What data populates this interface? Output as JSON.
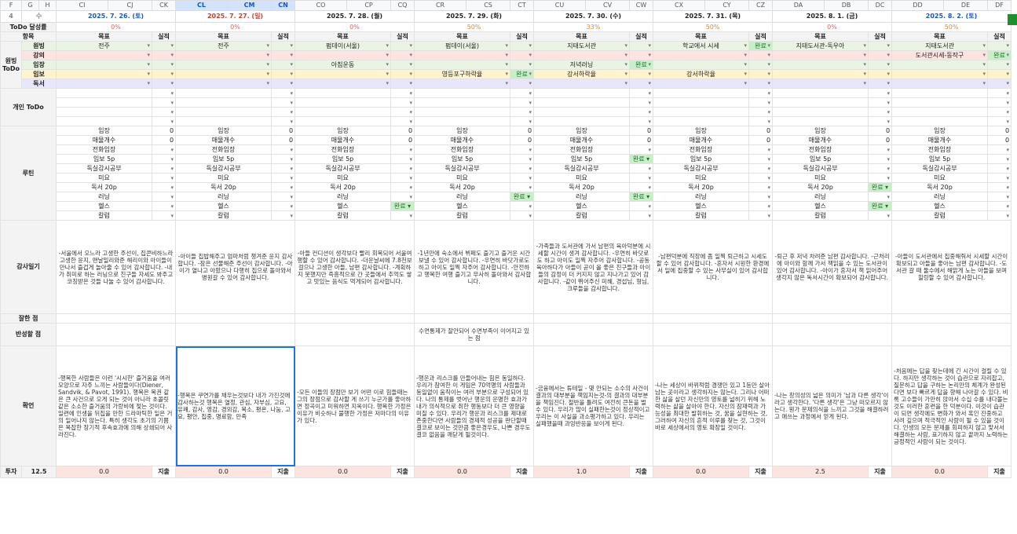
{
  "sheet": {
    "col_letters_left": [
      "F",
      "G",
      "H"
    ],
    "row_num": "4",
    "row_num_label": "수",
    "days": [
      {
        "cols": [
          "CI",
          "CJ",
          "CK"
        ],
        "date": "2025. 7. 26. (토)",
        "tone": "blue",
        "todo_pct": "0%",
        "selected": false
      },
      {
        "cols": [
          "CL",
          "CM",
          "CN"
        ],
        "date": "2025. 7. 27. (일)",
        "tone": "red",
        "todo_pct": "0%",
        "selected": true
      },
      {
        "cols": [
          "CO",
          "CP",
          "CQ"
        ],
        "date": "2025. 7. 28. (월)",
        "tone": "dark",
        "todo_pct": "0%",
        "selected": false
      },
      {
        "cols": [
          "CR",
          "CS",
          "CT"
        ],
        "date": "2025. 7. 29. (화)",
        "tone": "dark",
        "todo_pct": "50%",
        "selected": false
      },
      {
        "cols": [
          "CU",
          "CV",
          "CW"
        ],
        "date": "2025. 7. 30. (수)",
        "tone": "dark",
        "todo_pct": "33%",
        "selected": false
      },
      {
        "cols": [
          "CX",
          "CY",
          "CZ"
        ],
        "date": "2025. 7. 31. (목)",
        "tone": "dark",
        "todo_pct": "50%",
        "selected": false
      },
      {
        "cols": [
          "DA",
          "DB",
          "DC"
        ],
        "date": "2025. 8. 1. (금)",
        "tone": "dark",
        "todo_pct": "0%",
        "selected": false
      },
      {
        "cols": [
          "DD",
          "DE",
          "DF"
        ],
        "date": "2025. 8. 2. (토)",
        "tone": "blue",
        "todo_pct": "50%",
        "selected": false
      }
    ]
  },
  "labels": {
    "todo_rate": "ToDo 달성률",
    "item": "항목",
    "goal": "목표",
    "result": "실적",
    "wonbing_todo": "원빙 ToDo",
    "personal_todo": "개인 ToDo",
    "routine": "루틴",
    "gratitude": "감사일기",
    "good": "잘한 점",
    "reflect": "반성할 점",
    "confirm": "확언",
    "invest": "투자",
    "invest_value": "12.5",
    "expense": "지출"
  },
  "wonbing_rows": [
    {
      "name": "원빙",
      "tone": "g1",
      "goals": [
        "전주",
        "전주",
        "펌데이(서울)",
        "펌데이(서울)",
        "지태도서관",
        "학교에서 시세",
        "지태도서관-독우아",
        "지태도서관"
      ],
      "results": [
        "",
        "",
        "",
        "",
        "",
        "완료",
        "",
        ""
      ]
    },
    {
      "name": "강의",
      "tone": "r1",
      "goals": [
        "",
        "",
        "",
        "",
        "",
        "",
        "",
        "도서관시세-동작구"
      ],
      "results": [
        "",
        "",
        "",
        "",
        "",
        "",
        "",
        "완료"
      ]
    },
    {
      "name": "임장",
      "tone": "g1",
      "goals": [
        "",
        "",
        "아침운동",
        "",
        "저녁러닝",
        "",
        "",
        ""
      ],
      "results": [
        "",
        "",
        "",
        "",
        "완료",
        "",
        "",
        ""
      ]
    },
    {
      "name": "임보",
      "tone": "y1",
      "goals": [
        "",
        "",
        "",
        "영등포구하락율",
        "강서하락율",
        "강서하락율",
        "",
        ""
      ],
      "results": [
        "",
        "",
        "",
        "완료",
        "",
        "",
        "",
        ""
      ]
    },
    {
      "name": "독서",
      "tone": "p1",
      "goals": [
        "",
        "",
        "",
        "",
        "",
        "",
        "",
        ""
      ],
      "results": [
        "",
        "",
        "",
        "",
        "",
        "",
        "",
        ""
      ]
    }
  ],
  "routines": [
    {
      "name": "임장",
      "value": "0"
    },
    {
      "name": "매물개수",
      "value": "0"
    },
    {
      "name": "전화임장",
      "value": ""
    },
    {
      "name": "임보 5p",
      "value": ""
    },
    {
      "name": "독실감시공부",
      "value": ""
    },
    {
      "name": "미요",
      "value": ""
    },
    {
      "name": "독서 20p",
      "value": ""
    },
    {
      "name": "러닝",
      "value": ""
    },
    {
      "name": "헬스",
      "value": ""
    },
    {
      "name": "칼럼",
      "value": ""
    }
  ],
  "routine_done": {
    "3_4": "완료",
    "4_4": "",
    "7_4": "완료",
    "8_2": "완료",
    "6_6": "완료",
    "8_6": "완료",
    "7_3": "완료"
  },
  "gratitude": [
    "-서울에서 오느라 고생한 주선이, 집콘비하느라 고생한 윤지, 맨날밀리와준 해리이와 아이들이 만나서 즐겁게 놀아줄 수 있어 감사합니다.\n-내가 취미로 하는 러닝으로 친구들 자세도 봐주고 코칭받은 것들 나눌 수 있어 감사합니다.",
    "-아이들 집밥해주고 엄마처럼 챙겨준 윤지 감사합니다.\n-잠은 선물해준 주선이 감사합니다.\n-아이가 열나고 아팠으나 다행히 집으로 돌아와서 병원갈 수 있어 감사합니다.",
    "-아들 컨디션이 생각보다 빨리 회복되어 서울여행할 수 있어 감사합니다.\n-더운날씨에 7.8천보 걸으나 고생한 아들, 남편 감사합니다.\n-계획하지 못했지만 즉흥적으로 간 곳들에서 추억도 쌓고 맛있는 음식도 먹게되어 감사합니다.",
    "-1년만에 숙소에서 뷔페도 즐기고 즐거운 시간 보낼 수 있어 감사합니다.\n-우연히 바닷가로도 하고 아이도 일찍 자주어 감사합니다.\n-안전하고 행복한 여행 즐기고 무사히 돌아와서 감사합니다.",
    "-가족들과 도서관에 가서 남편의 육아덕분에 시세할 시간이 생겨 감사합니다.\n-우연히 바닷로도 하고 아이도 일찍 자주어 감사합니다.\n-공동육아하다가 아들이 곧이 올 좋은 친구들과 아이들의 감정이 더 커지지 않고 지나가고 있어 감사합니다.\n-같이 뛰어주신 미혜, 경섭님, 형님, 크루들을 감사합니다.",
    "-남편덕분에 직장에 좀 일찍 퇴근하고 시세도 할 수 있어 감사합니다.\n-혼자서 시원한 환경에서 일에 집중할 수 있는 사무실이 있어 감사합니다.",
    "-퇴근 후 저녁 차려준 남편 감사합니다.\n-근처리에 아이와 함께 가서 책읽을 수 있는 도서관이 있어 감사합니다.\n-아이가 혼자서 책 읽어주어 생각지 않은 독서시간이 확보되어 감사합니다.",
    "-아들이 도서관에서 집중해줘서 시세할 시간이 확보되고 아들을 좋아는 남편 감사합니다.\n-도서관 갈 때 둘수에서 해맑게 노는 아들을 보며 힐링할 수 있어 감사합니다."
  ],
  "reflect_note": "수면통제가 잘안되어 수면부족이 이어지고 있는 점",
  "confirm": [
    "-행복한 사람들은 이런 '시시한' 즐거움을 여러 모양으로 자주 느끼는 사람들이다(Diener, Sandvik, & Pavot, 1991). 행복은 복권 같은 큰 사건으로 오게 되는 것이 아니라 초콜릿 같은 소소한 즐거움의 가랑비에 젖는 것이다. 일련에 인생을 뒤집을 만한 드라마틱한 일은 거의 일어나지 않는다. 특히 생각도 초기의 기쁨은 복잡한 장기적 후속효과에 의해 상쇄되어 사라진다.",
    "-행복은 쿠연가를 채우는것보다 내가 가진것에 감사하는것\n행복은 열정, 관심, 자부심, 고요, 유쾌, 감사, 영감, 경외감, 목소, 평온, 나눔, 고요, 평안, 집중, 명료함, 만족",
    "-모든 이들의 장점만 보기\n어떤 이로 힘들때는 그의 장점으로 감사할 게 쓰기\n누군가를 좋아하면 정곡이고 미워하면 지옥이다.\n행복한 가정은 이유가 비슷하나 불행한 가정은 저마다의 이유가 있다.",
    "-행운과 리스크를 만들어내는 힘은 동일하다. 우리가 참여한 이 게임은 70억명의 사람들과 동일없이 움직이는 여러 부분으로 구성되어 있다. 나의 통제를 벗어난 행운의 운명한 효과가 내가 의식적으로 취한 행동보다 더 큰 영향을 미칠 수 있다.\n우리가 행운과 리스크를 제대로 존중한다면 사람들의 경제적 성공을 판단할때 결코로 보이는 것만큼 좋은경우도, 나쁜 경우도 결코 없음을 깨닫게 될것이다.",
    "-금융에서는 튜테일 - 몇 안되는 소수의 사건이 결과의 대부분을 책임지는것-의 결과의 대부분을 책임진다. 절반을 틀려도 여전히 큰돈을 벌수 있다. 우리가 많이 실패한는것이 정상적이고 우리는 이 사실을 과소평가하고 있다. 우리는 실패했을때 과잉반응을 보이게 된다.",
    "-나는 세상이 바뀌적럼 경쟁만 있고 1등만 살아남는 곳이라고 생각하지는 않는다. 그리나 어떠한 삶을 살던 자신만의 영토를 넓히기 위해 노력하는 삶을 살아야 한다. 자신의 잠재력과 가능성을 최대한 발휘하는 것, 꿈을 실현하는 것, 그러하여 자신의 흔적 이루를 찾는 것, 그것이 바로 세상에서의 영토 확장일 것이다.",
    "-나는 창의성의 넓은 의미가 '남과 다른 생각'이라고 생각한다. '다른 생각'은 그냥 떠오르지 않는다. 뭔가 문제의식을 느끼고 그것을 해결하려고 애쓰는 과정에서 얻게 된다.",
    "-처음에는 답을 찾는데에 긴 시간이 걸릴 수 있다. 하지만 생각하는 것이 습관으로 자리잡고, 질문하고 답을 구하는 논리만의 체계가 완성된다면 보다 빠르게 답을 향해 나아갈 수 있다. 비록 고수들이 가만히 앉아서 수십 수를 내다볼는 것도 이러한 훈련을 한 덕분이다. 이것이 습관이 되면 생각에도 변화가 와서 혹인 진중하고 사려 깊으며 적극적인 사람이 될 수 있을 것이다. 인생의 모든 문제를 회피하지 않고 맞서서 해결하는 사람, 표기하지 않고 끝까지 노력하는 긍정적인 사람이 되는 것이다."
  ],
  "invest_values": [
    "0.0",
    "0.0",
    "0.0",
    "0.0",
    "1.0",
    "0.0",
    "2.5",
    "0.0"
  ],
  "colors": {
    "accent_select": "#1a73e8",
    "done_bg": "#c8efc8",
    "wonbing_green": "#e9f5e2",
    "lecture_red": "#fde4e1",
    "report_yellow": "#fff3cd",
    "reading_purple": "#e8e6fa"
  }
}
